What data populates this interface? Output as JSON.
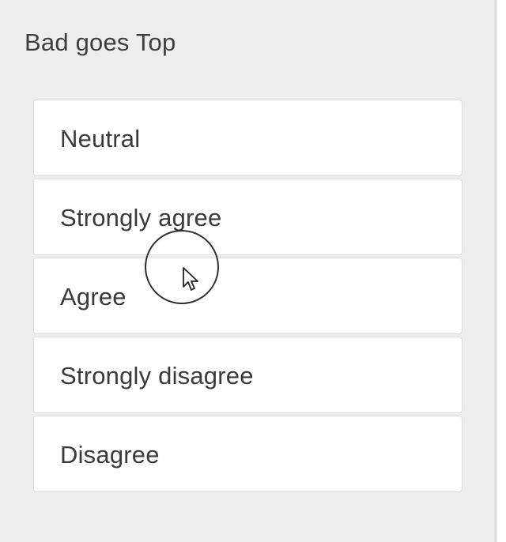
{
  "panel": {
    "title": "Bad goes Top"
  },
  "ranking": {
    "items": [
      {
        "label": "Neutral"
      },
      {
        "label": "Strongly agree"
      },
      {
        "label": "Agree"
      },
      {
        "label": "Strongly disagree"
      },
      {
        "label": "Disagree"
      }
    ]
  },
  "cursor": {
    "icon": "arrow-cursor-icon",
    "highlight_icon": "click-highlight-ring-icon"
  },
  "colors": {
    "panel_background": "#eeeeee",
    "item_background": "#ffffff",
    "item_border": "#dcdcdc",
    "text": "#3a3a3a"
  }
}
